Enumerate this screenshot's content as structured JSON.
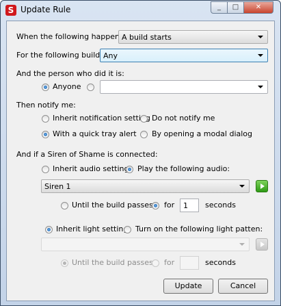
{
  "window": {
    "title": "Update Rule",
    "min_glyph": "_",
    "max_glyph": "□",
    "close_glyph": "✕"
  },
  "trigger": {
    "label": "When the following happens:",
    "value": "A build starts"
  },
  "build": {
    "label": "For the following build:",
    "value": "Any"
  },
  "person": {
    "label": "And the person who did it is:",
    "anyone_label": "Anyone",
    "anyone_selected": true,
    "specific_value": ""
  },
  "notify": {
    "label": "Then notify me:",
    "options": [
      {
        "label": "Inherit notification setting",
        "selected": false
      },
      {
        "label": "Do not notify me",
        "selected": false
      },
      {
        "label": "With a quick tray alert",
        "selected": true
      },
      {
        "label": "By opening a modal dialog",
        "selected": false
      }
    ]
  },
  "siren": {
    "label": "And if a Siren of Shame is connected:",
    "audio": {
      "inherit_label": "Inherit audio setting",
      "inherit_selected": false,
      "play_label": "Play the following audio:",
      "play_selected": true,
      "selected": "Siren 1",
      "until_label": "Until the build passes",
      "until_selected": false,
      "for_label": "for",
      "for_selected": true,
      "duration": "1",
      "seconds_label": "seconds"
    },
    "light": {
      "inherit_label": "Inherit light setting",
      "inherit_selected": true,
      "pattern_label": "Turn on the following light patten:",
      "pattern_selected": false,
      "selected": "",
      "until_label": "Until the build passes",
      "until_selected": true,
      "for_label": "for",
      "for_selected": false,
      "duration": "",
      "seconds_label": "seconds"
    }
  },
  "buttons": {
    "update": "Update",
    "cancel": "Cancel"
  },
  "colors": {
    "accent_focus": "#3c7fb1",
    "play_green": "#2f9a15",
    "app_icon_red": "#d0181d"
  }
}
